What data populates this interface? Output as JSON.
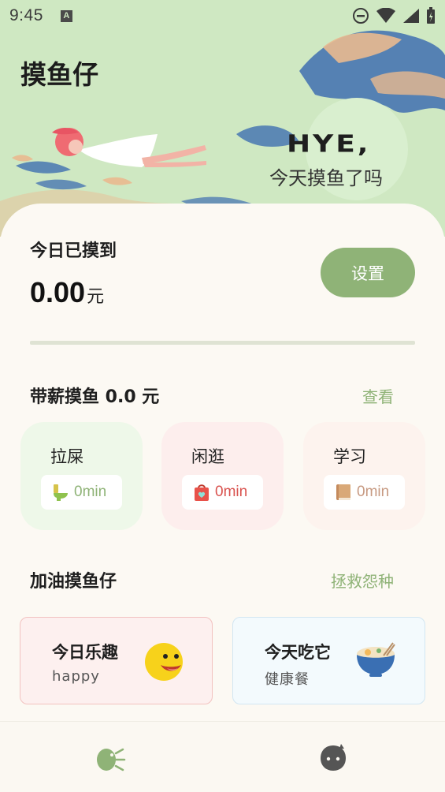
{
  "status_bar": {
    "time": "9:45",
    "notif_letter": "A"
  },
  "header": {
    "title": "摸鱼仔",
    "banner_word": "HYE,",
    "banner_sub": "今天摸鱼了吗"
  },
  "today": {
    "label": "今日已摸到",
    "amount": "0.00",
    "unit": "元",
    "settings_label": "设置"
  },
  "paid_slack": {
    "title": "带薪摸鱼 0.0 元",
    "link": "查看",
    "items": [
      {
        "label": "拉屎",
        "time": "0min",
        "icon": "toilet-icon",
        "bg": "#eef8e9",
        "color": "#8fb377"
      },
      {
        "label": "闲逛",
        "time": "0min",
        "icon": "shopping-bag-icon",
        "bg": "#fdeeed",
        "color": "#d9534f"
      },
      {
        "label": "学习",
        "time": "0min",
        "icon": "book-icon",
        "bg": "#fdf3ee",
        "color": "#c79a82"
      }
    ]
  },
  "cheer": {
    "title": "加油摸鱼仔",
    "link": "拯救怨种",
    "cards": [
      {
        "title": "今日乐趣",
        "sub": "happy",
        "icon": "smiley-icon",
        "bg": "#fdf0ef",
        "border": "#f2c2c0"
      },
      {
        "title": "今天吃它",
        "sub": "健康餐",
        "icon": "ramen-bowl-icon",
        "bg": "#f3fafd",
        "border": "#d2e6f2"
      }
    ]
  },
  "nav": {
    "items": [
      {
        "icon": "fish-icon"
      },
      {
        "icon": "ghost-face-icon"
      }
    ]
  },
  "colors": {
    "accent": "#8fb377",
    "hero_bg": "#cfe8c2",
    "page_bg": "#fcf9f3"
  }
}
